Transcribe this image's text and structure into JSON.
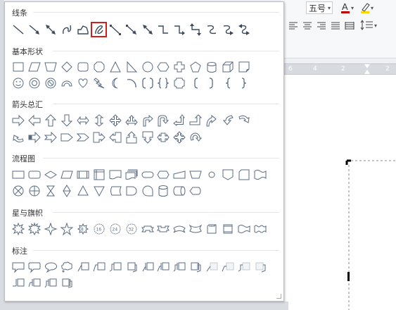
{
  "ribbon": {
    "font_size": "五号",
    "font_size_dropdown": "▾",
    "font_color_icon": "font-color-icon",
    "highlight_icon": "highlight-icon",
    "align_buttons": [
      "align-left-icon",
      "align-center-icon",
      "align-right-icon",
      "justify-icon",
      "distribute-icon"
    ],
    "line_spacing_icon": "line-spacing-icon"
  },
  "ruler": {
    "labels": [
      "6",
      "4",
      "2",
      "2"
    ]
  },
  "shapes_panel": {
    "sections": [
      {
        "title": "线条",
        "rows": [
          [
            "line",
            "arrow",
            "double-arrow",
            "curve",
            "freeform",
            "scribble",
            "elbow-connector",
            "elbow-arrow",
            "elbow-double-arrow",
            "curved-connector",
            "curved-arrow",
            "curved-double-arrow",
            "s-curve",
            "s-curve-arrow",
            "s-curve-double-arrow"
          ]
        ]
      },
      {
        "title": "基本形状",
        "rows": [
          [
            "rectangle",
            "parallelogram",
            "trapezoid",
            "diamond",
            "rounded-rect",
            "octagon",
            "triangle",
            "right-triangle",
            "circle",
            "hexagon",
            "cross",
            "pentagon",
            "cylinder",
            "cube",
            "folded-corner"
          ],
          [
            "smiley",
            "donut",
            "no-symbol",
            "arc-block",
            "heart",
            "lightning",
            "moon",
            "arc",
            "bracket-pair",
            "brace-pair",
            "plaque",
            "left-bracket",
            "right-bracket",
            "left-brace",
            "right-brace"
          ]
        ]
      },
      {
        "title": "箭头总汇",
        "rows": [
          [
            "right-arrow",
            "left-arrow",
            "up-arrow",
            "down-arrow",
            "left-right-arrow",
            "up-down-arrow",
            "quad-arrow",
            "left-right-up-arrow",
            "bent-arrow",
            "u-turn-arrow",
            "left-up-arrow",
            "bent-up-arrow",
            "curved-right-arrow",
            "curved-left-arrow",
            "curved-down-arrow"
          ],
          [
            "curved-up-arrow",
            "striped-right-arrow",
            "notched-arrow",
            "pentagon-arrow",
            "chevron",
            "right-arrow-callout",
            "left-arrow-callout",
            "up-arrow-callout",
            "down-arrow-callout",
            "left-right-arrow-callout",
            "quad-arrow-callout",
            "circular-arrow"
          ]
        ]
      },
      {
        "title": "流程图",
        "rows": [
          [
            "process",
            "alt-process",
            "decision",
            "data",
            "predefined",
            "internal-storage",
            "document",
            "multidocument",
            "terminator",
            "preparation",
            "manual-input",
            "manual-operation",
            "connector",
            "offpage-connector",
            "card",
            "punched-tape"
          ],
          [
            "summing-junction",
            "or",
            "collate",
            "sort",
            "extract",
            "merge",
            "stored-data",
            "delay",
            "sequential-storage",
            "magnetic-disk",
            "direct-storage",
            "display"
          ]
        ]
      },
      {
        "title": "星与旗帜",
        "rows": [
          [
            "explosion-1",
            "explosion-2",
            "star-4",
            "star-5",
            "star-8",
            "star-16",
            "star-24",
            "star-32",
            "ribbon-up",
            "ribbon-down",
            "curved-ribbon-up",
            "curved-ribbon-down",
            "vertical-scroll",
            "horizontal-scroll",
            "wave",
            "double-wave"
          ]
        ]
      },
      {
        "title": "标注",
        "rows": [
          [
            "rect-callout",
            "rounded-rect-callout",
            "oval-callout",
            "cloud-callout",
            "line-callout-1",
            "line-callout-2",
            "line-callout-3",
            "line-callout-4",
            "line-callout-1-accent",
            "line-callout-2-accent",
            "line-callout-3-accent",
            "line-callout-4-accent",
            "line-callout-1-nb",
            "line-callout-2-nb",
            "line-callout-3-nb",
            "line-callout-4-nb"
          ],
          [
            "line-callout-1-bar",
            "line-callout-2-bar",
            "line-callout-3-bar",
            "line-callout-4-bar"
          ]
        ]
      }
    ],
    "selected": "scribble"
  }
}
